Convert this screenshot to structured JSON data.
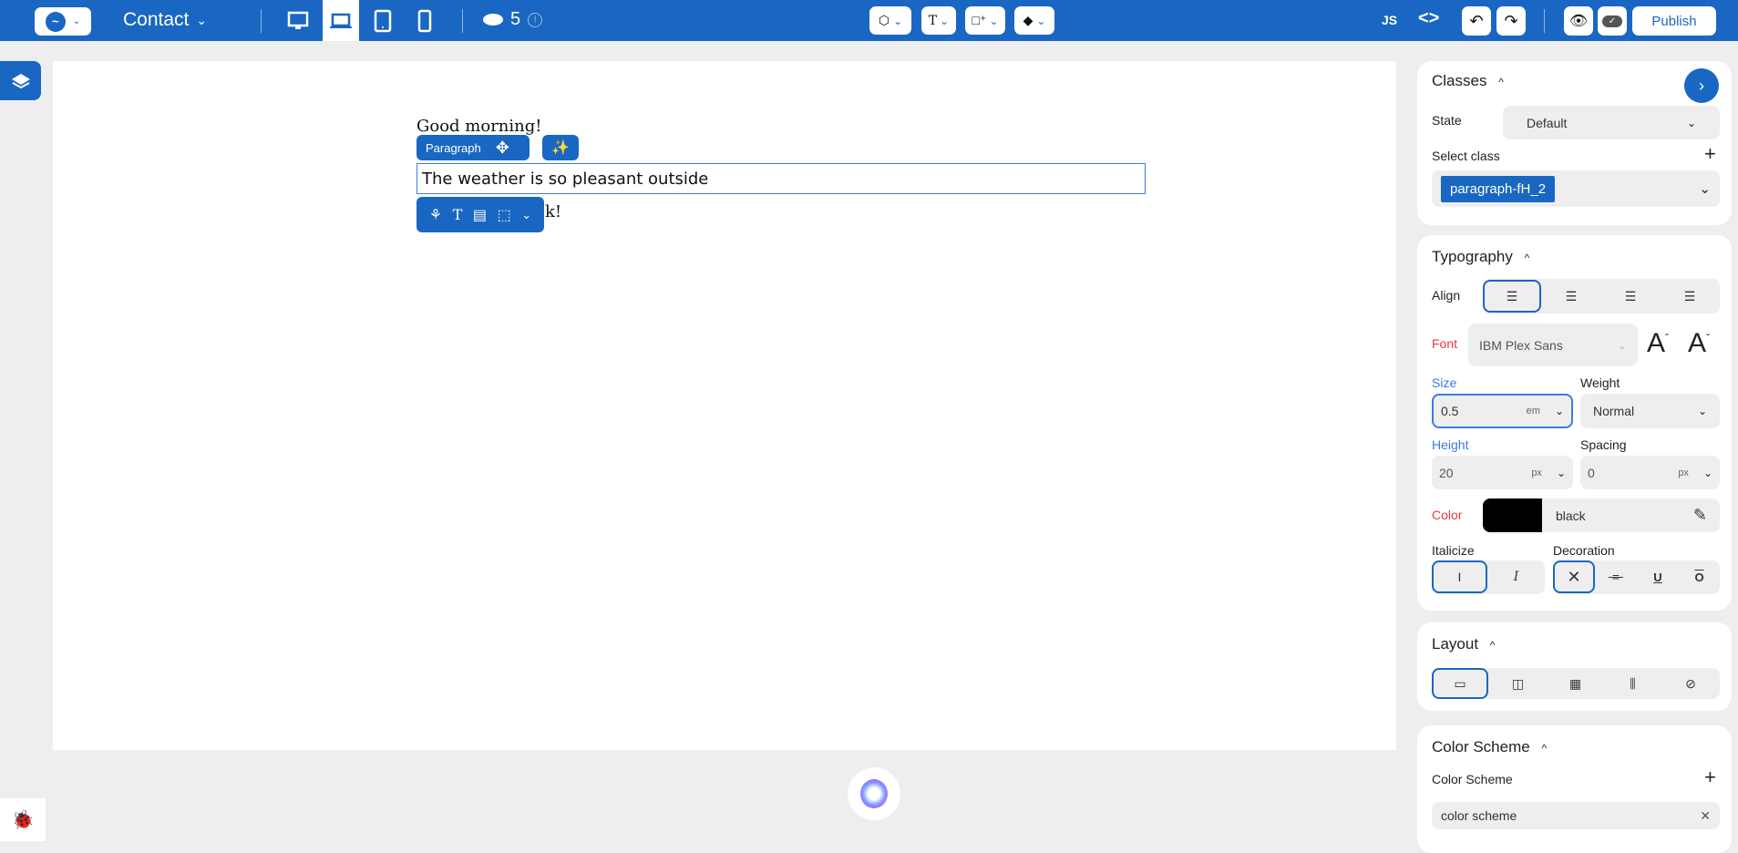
{
  "topbar": {
    "page_name": "Contact",
    "layers_count": "5",
    "js_label": "JS",
    "publish_label": "Publish",
    "icons": [
      "logo-icon",
      "desktop-icon",
      "laptop-icon",
      "tablet-icon",
      "mobile-icon",
      "database-icon",
      "info-icon",
      "component-icon",
      "text-icon",
      "add-element-icon",
      "contrast-icon",
      "code-icon",
      "undo-icon",
      "redo-icon",
      "preview-eye-icon",
      "cloud-save-icon"
    ],
    "active_device": "laptop"
  },
  "canvas": {
    "line1": "Good morning!",
    "badge_label": "Paragraph",
    "selected_text": "The weather is so pleasant outside",
    "line3_visible": "k!"
  },
  "panel": {
    "classes": {
      "title": "Classes",
      "state_label": "State",
      "state_value": "Default",
      "select_class_label": "Select class",
      "class_chip": "paragraph-fH_2"
    },
    "typography": {
      "title": "Typography",
      "align_label": "Align",
      "align_selected": "left",
      "font_label": "Font",
      "font_value": "IBM Plex Sans",
      "size_label": "Size",
      "size_value": "0.5",
      "size_unit": "em",
      "weight_label": "Weight",
      "weight_value": "Normal",
      "height_label": "Height",
      "height_value": "20",
      "height_unit": "px",
      "spacing_label": "Spacing",
      "spacing_value": "0",
      "spacing_unit": "px",
      "color_label": "Color",
      "color_value": "black",
      "color_swatch": "#000000",
      "italicize_label": "Italicize",
      "decoration_label": "Decoration"
    },
    "layout": {
      "title": "Layout",
      "selected": "block"
    },
    "color_scheme": {
      "title": "Color Scheme",
      "label": "Color Scheme",
      "value": "color scheme"
    }
  },
  "colors": {
    "accent": "#1967c2",
    "label_red": "#e53945",
    "label_blue": "#3b7be8"
  }
}
